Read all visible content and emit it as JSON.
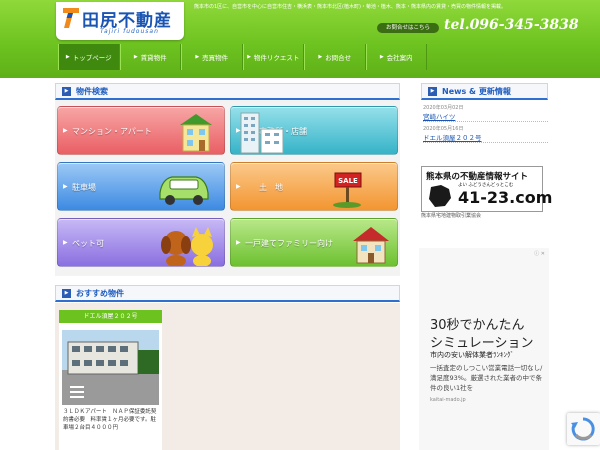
{
  "header": {
    "logo_text": "田尻不動産",
    "logo_subtext": "Tajiri fudousan",
    "note": "熊本市の1区に、自営市を中心に自営市住吉・横浜表・熊本市北区(植木町)・菊池・植木、熊本・熊本県内の賃貸・売買の物件情報を掲載。",
    "email_button": "お問合せはこちら",
    "tel": "tel.096-345-3838"
  },
  "nav": {
    "items": [
      {
        "label": "トップページ",
        "active": true
      },
      {
        "label": "賃貸物件",
        "active": false
      },
      {
        "label": "売買物件",
        "active": false
      },
      {
        "label": "物件リクエスト",
        "active": false
      },
      {
        "label": "お問合せ",
        "active": false
      },
      {
        "label": "会社案内",
        "active": false
      }
    ]
  },
  "search": {
    "title": "物件検索",
    "tiles": [
      {
        "label": "マンション・アパート",
        "icon": "apartment-icon",
        "color": "#e95f64"
      },
      {
        "label": "事務所・店舗",
        "icon": "office-building-icon",
        "color": "#36b3c8"
      },
      {
        "label": "駐車場",
        "icon": "car-icon",
        "color": "#3d8ae2"
      },
      {
        "label": "土　地",
        "icon": "sale-sign-icon",
        "color": "#f39531"
      },
      {
        "label": "ペット可",
        "icon": "pets-icon",
        "color": "#8a6fe0"
      },
      {
        "label": "一戸建てファミリー向け",
        "icon": "house-icon",
        "color": "#6cc12f"
      }
    ]
  },
  "recommend": {
    "title": "おすすめ物件",
    "card_title": "ドエル須屋２０２号",
    "card_text": "３ＬＤＫアパート　ＮＡＰ保証委託契約書必要　料率賃１ヶ月必要です。駐車場２台目４０００円"
  },
  "news": {
    "title": "News & 更新情報",
    "items": [
      {
        "date": "2020年03月02日",
        "link": "宮崎ハイツ"
      },
      {
        "date": "2020年05月16日",
        "link": "ドエル須屋２０２号"
      }
    ]
  },
  "banner": {
    "title": "熊本県の不動産情報サイト",
    "subtitle": "よい ふどうさんどっとこむ",
    "number": "41-23.com",
    "caption": "熊本県宅地建物取引業協会"
  },
  "ad": {
    "info": "ⓘ ✕",
    "headline1": "30秒でかんたん",
    "headline2": "シミュレーション",
    "sub": "市内の安い解体業者ﾗﾝｷﾝｸﾞ",
    "body": "一括査定のしつこい営業電話一切なし/満足度93%。厳選された業者の中で条件の良い1社を",
    "url": "kaitai-mado.jp"
  },
  "colors": {
    "header_green": "#6cc21f",
    "nav_active": "#3f8a0e",
    "brand_blue": "#1a55b3"
  }
}
